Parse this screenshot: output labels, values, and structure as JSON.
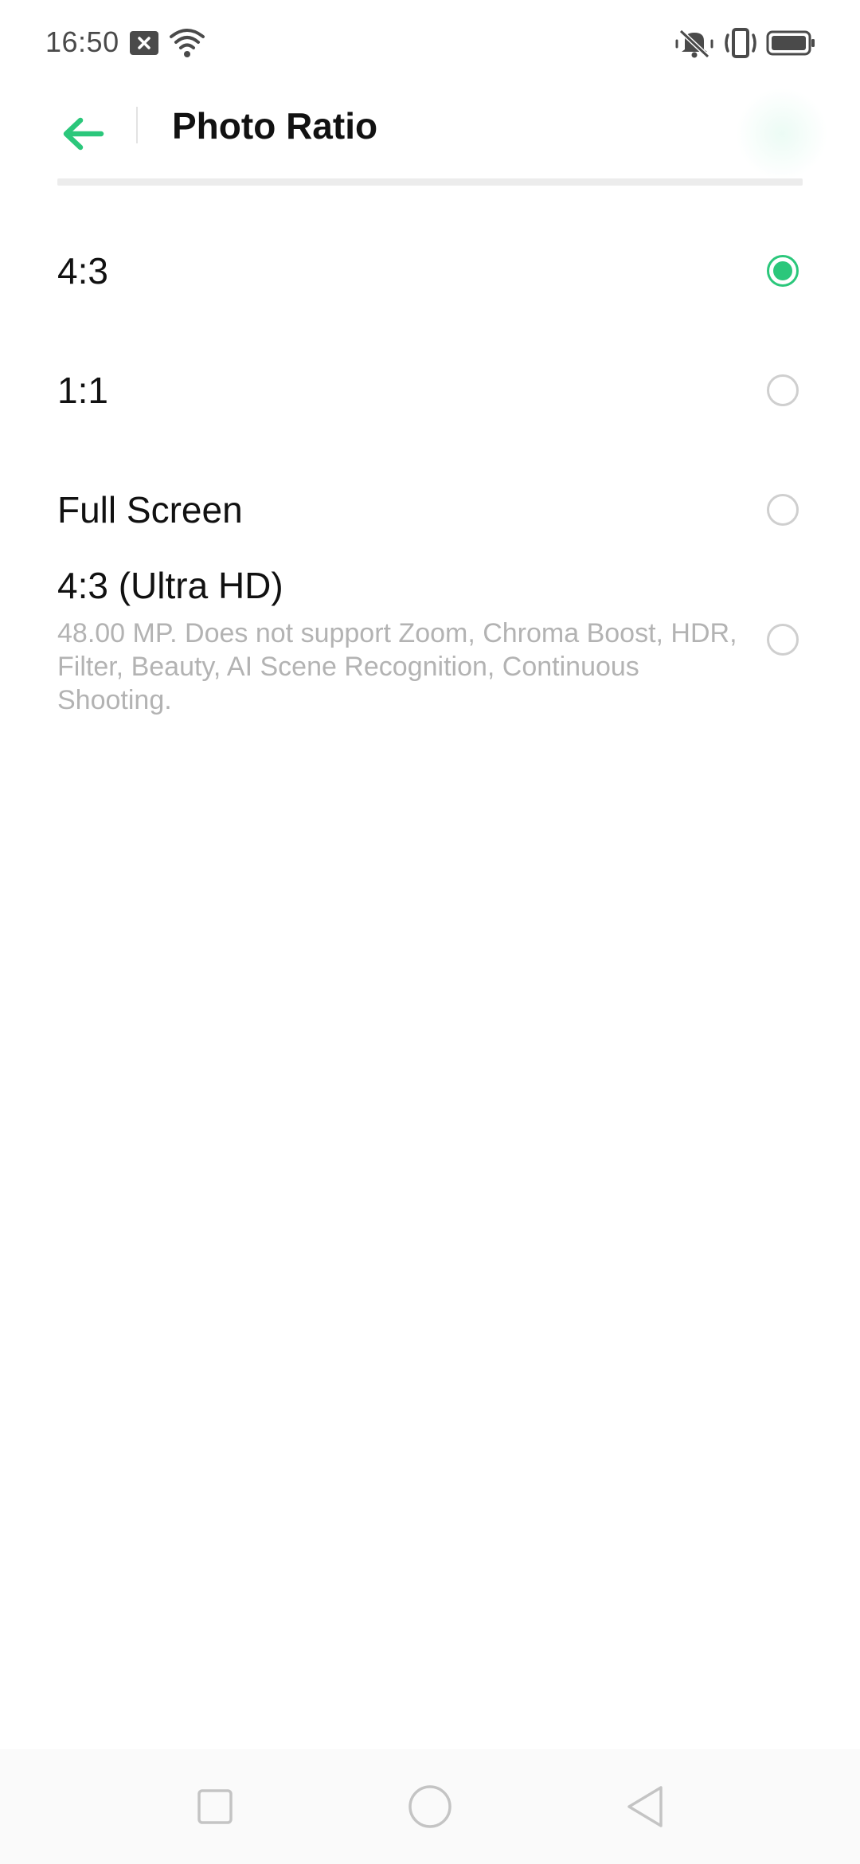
{
  "status_bar": {
    "time": "16:50"
  },
  "header": {
    "title": "Photo Ratio",
    "accent_color": "#2bc77b"
  },
  "options": [
    {
      "label": "4:3",
      "description": "",
      "selected": true
    },
    {
      "label": "1:1",
      "description": "",
      "selected": false
    },
    {
      "label": "Full Screen",
      "description": "",
      "selected": false
    },
    {
      "label": "4:3 (Ultra HD)",
      "description": "48.00 MP. Does not support Zoom, Chroma Boost, HDR, Filter, Beauty, AI Scene Recognition, Continuous Shooting.",
      "selected": false
    }
  ],
  "icons": {
    "back": "arrow-left-icon",
    "notification": "notification-close-icon",
    "wifi": "wifi-icon",
    "silent": "bell-off-icon",
    "vibrate": "vibrate-icon",
    "battery": "battery-icon",
    "nav_recents": "square-icon",
    "nav_home": "circle-icon",
    "nav_back": "triangle-back-icon"
  }
}
